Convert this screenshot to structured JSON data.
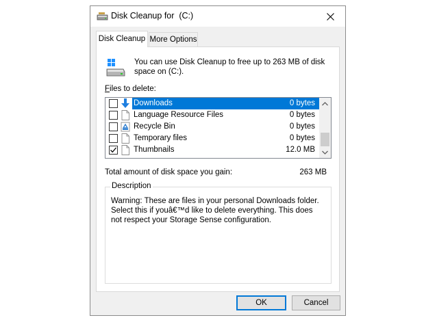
{
  "window": {
    "title": "Disk Cleanup for  (C:)",
    "title_icon": "disk-cleanup-icon",
    "close_icon": "close-icon"
  },
  "tabs": [
    {
      "label": "Disk Cleanup",
      "active": true
    },
    {
      "label": "More Options",
      "active": false
    }
  ],
  "intro": {
    "text": "You can use Disk Cleanup to free up to 263 MB of disk space on  (C:).",
    "icon": "drive-icon"
  },
  "files": {
    "label_accel": "F",
    "label_rest": "iles to delete:",
    "items": [
      {
        "name": "Downloads",
        "size": "0 bytes",
        "checked": false,
        "selected": true,
        "icon": "download-arrow-icon"
      },
      {
        "name": "Language Resource Files",
        "size": "0 bytes",
        "checked": false,
        "selected": false,
        "icon": "file-icon"
      },
      {
        "name": "Recycle Bin",
        "size": "0 bytes",
        "checked": false,
        "selected": false,
        "icon": "recycle-bin-icon"
      },
      {
        "name": "Temporary files",
        "size": "0 bytes",
        "checked": false,
        "selected": false,
        "icon": "file-icon"
      },
      {
        "name": "Thumbnails",
        "size": "12.0 MB",
        "checked": true,
        "selected": false,
        "icon": "file-icon"
      }
    ]
  },
  "total": {
    "label": "Total amount of disk space you gain:",
    "value": "263 MB"
  },
  "description": {
    "legend": "Description",
    "text": "Warning: These are files in your personal Downloads folder. Select this if youâ€™d like to delete everything. This does not respect your Storage Sense configuration."
  },
  "buttons": {
    "ok": "OK",
    "cancel": "Cancel"
  },
  "colors": {
    "selection": "#0078d7",
    "window_bg": "#f0f0f0",
    "accent": "#0078d7"
  }
}
